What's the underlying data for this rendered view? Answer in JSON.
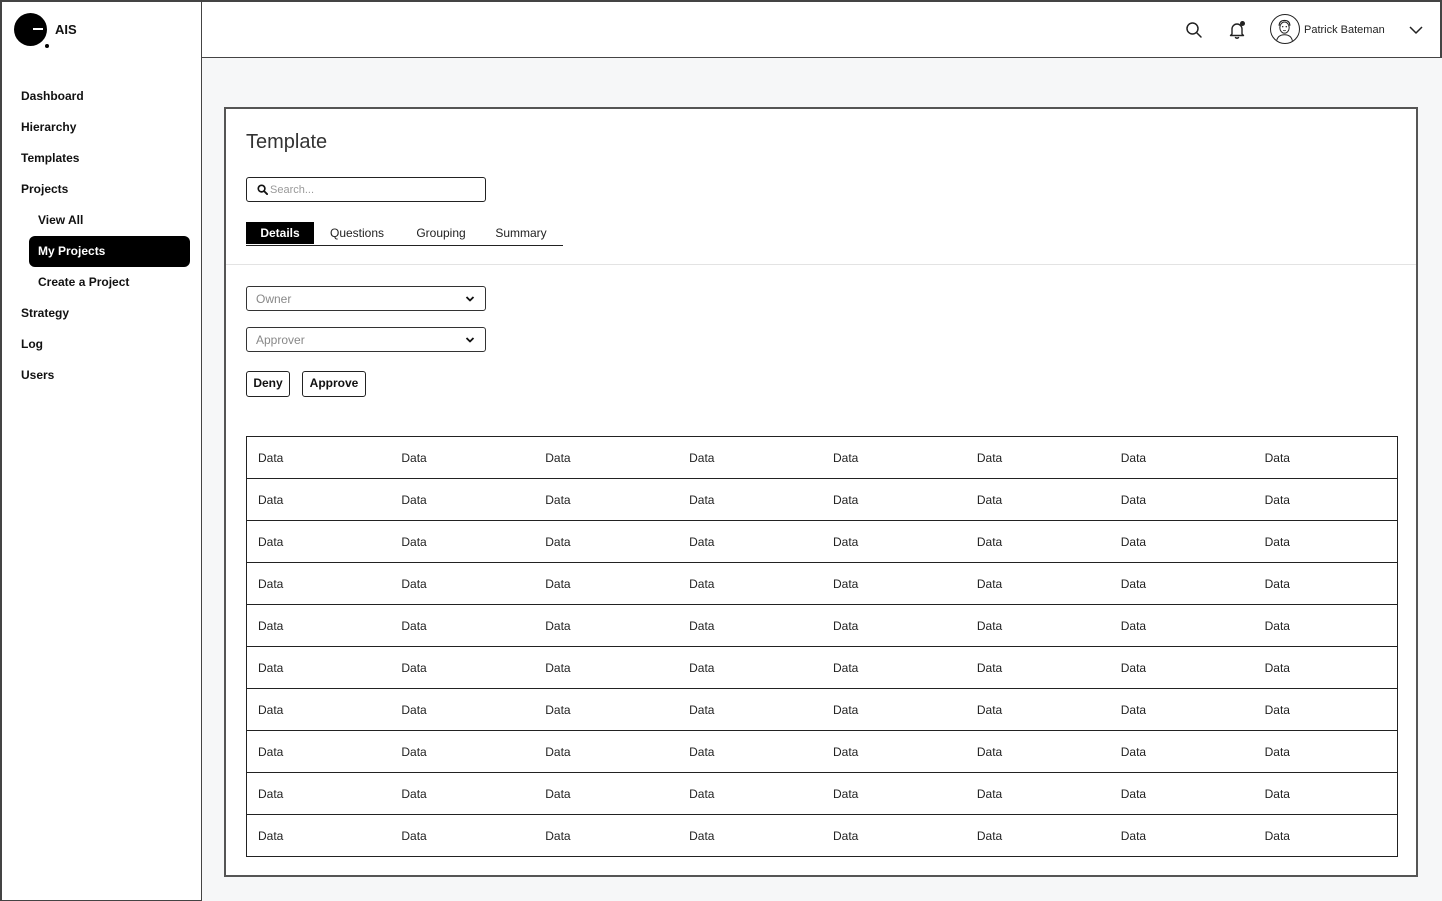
{
  "app": {
    "logo_text": "AIS"
  },
  "header": {
    "user_name": "Patrick Bateman",
    "notification_dot": true
  },
  "sidebar": {
    "items": [
      {
        "label": "Dashboard"
      },
      {
        "label": "Hierarchy"
      },
      {
        "label": "Templates"
      },
      {
        "label": "Projects"
      },
      {
        "label": "View All"
      },
      {
        "label": "My Projects",
        "active": true
      },
      {
        "label": "Create a Project"
      },
      {
        "label": "Strategy"
      },
      {
        "label": "Log"
      },
      {
        "label": "Users"
      }
    ]
  },
  "main": {
    "title": "Template",
    "search": {
      "placeholder": "Search...",
      "value": ""
    },
    "tabs": [
      {
        "label": "Details",
        "active": true
      },
      {
        "label": "Questions"
      },
      {
        "label": "Grouping"
      },
      {
        "label": "Summary"
      }
    ],
    "owner_select": {
      "placeholder": "Owner"
    },
    "approver_select": {
      "placeholder": "Approver"
    },
    "deny_label": "Deny",
    "approve_label": "Approve",
    "table": {
      "rows": [
        [
          "Data",
          "Data",
          "Data",
          "Data",
          "Data",
          "Data",
          "Data",
          "Data"
        ],
        [
          "Data",
          "Data",
          "Data",
          "Data",
          "Data",
          "Data",
          "Data",
          "Data"
        ],
        [
          "Data",
          "Data",
          "Data",
          "Data",
          "Data",
          "Data",
          "Data",
          "Data"
        ],
        [
          "Data",
          "Data",
          "Data",
          "Data",
          "Data",
          "Data",
          "Data",
          "Data"
        ],
        [
          "Data",
          "Data",
          "Data",
          "Data",
          "Data",
          "Data",
          "Data",
          "Data"
        ],
        [
          "Data",
          "Data",
          "Data",
          "Data",
          "Data",
          "Data",
          "Data",
          "Data"
        ],
        [
          "Data",
          "Data",
          "Data",
          "Data",
          "Data",
          "Data",
          "Data",
          "Data"
        ],
        [
          "Data",
          "Data",
          "Data",
          "Data",
          "Data",
          "Data",
          "Data",
          "Data"
        ],
        [
          "Data",
          "Data",
          "Data",
          "Data",
          "Data",
          "Data",
          "Data",
          "Data"
        ],
        [
          "Data",
          "Data",
          "Data",
          "Data",
          "Data",
          "Data",
          "Data",
          "Data"
        ]
      ]
    }
  },
  "colors": {
    "active_bg": "#000000",
    "page_bg": "#f6f7f8",
    "border": "#222222"
  },
  "icons": [
    "logo-icon",
    "search-icon",
    "bell-icon",
    "avatar-icon",
    "chevron-down-icon"
  ]
}
